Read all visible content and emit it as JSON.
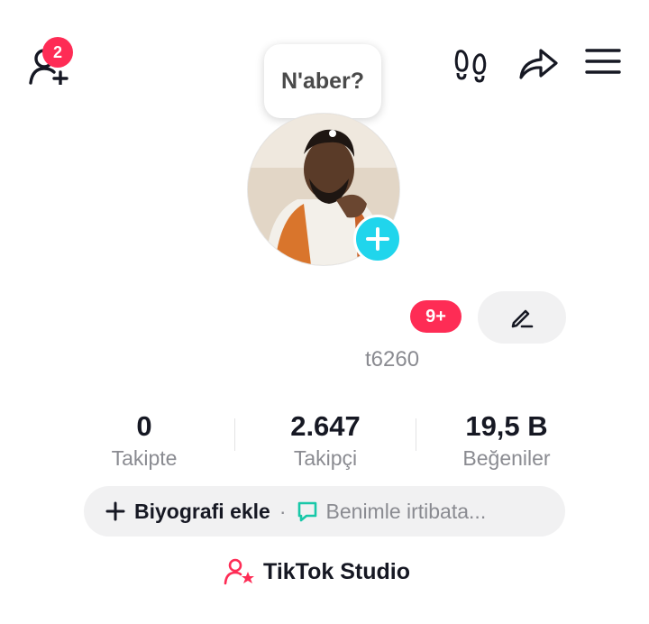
{
  "header": {
    "friend_requests_count": "2"
  },
  "bubble": {
    "text": "N'aber?"
  },
  "profile": {
    "notification_count": "9+",
    "username": "t6260"
  },
  "stats": [
    {
      "value": "0",
      "label": "Takipte"
    },
    {
      "value": "2.647",
      "label": "Takipçi"
    },
    {
      "value": "19,5 B",
      "label": "Beğeniler"
    }
  ],
  "bio": {
    "add_label": "Biyografi ekle",
    "separator": "·",
    "contact_label": "Benimle irtibata..."
  },
  "studio": {
    "label": "TikTok Studio"
  },
  "colors": {
    "accent": "#fe2c55",
    "cyan": "#20d5ec",
    "muted": "#8a8b91"
  }
}
